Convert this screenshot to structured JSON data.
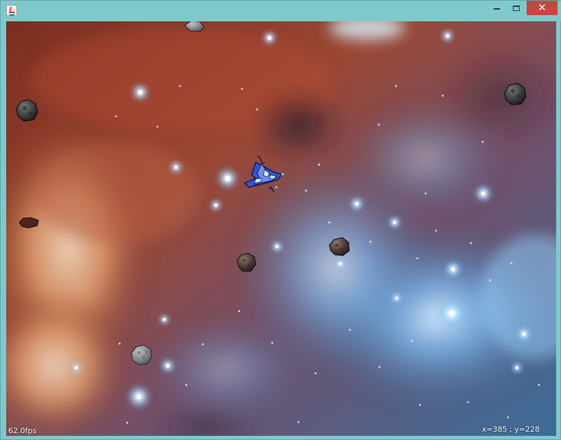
{
  "window": {
    "app_icon": "java-cup-icon",
    "controls": {
      "minimize": "minimize-icon",
      "maximize": "maximize-icon",
      "close": "close-icon"
    }
  },
  "game": {
    "fps_label": "62.0fps",
    "player_position_label": "x=385 ; y=228",
    "player_ship": "spaceship",
    "asteroid_count": 7,
    "colors": {
      "nebula_red": "#8e3f2a",
      "nebula_orange": "#e0a070",
      "star_blue": "#7ec8ff",
      "ship_blue": "#3057d6"
    }
  }
}
